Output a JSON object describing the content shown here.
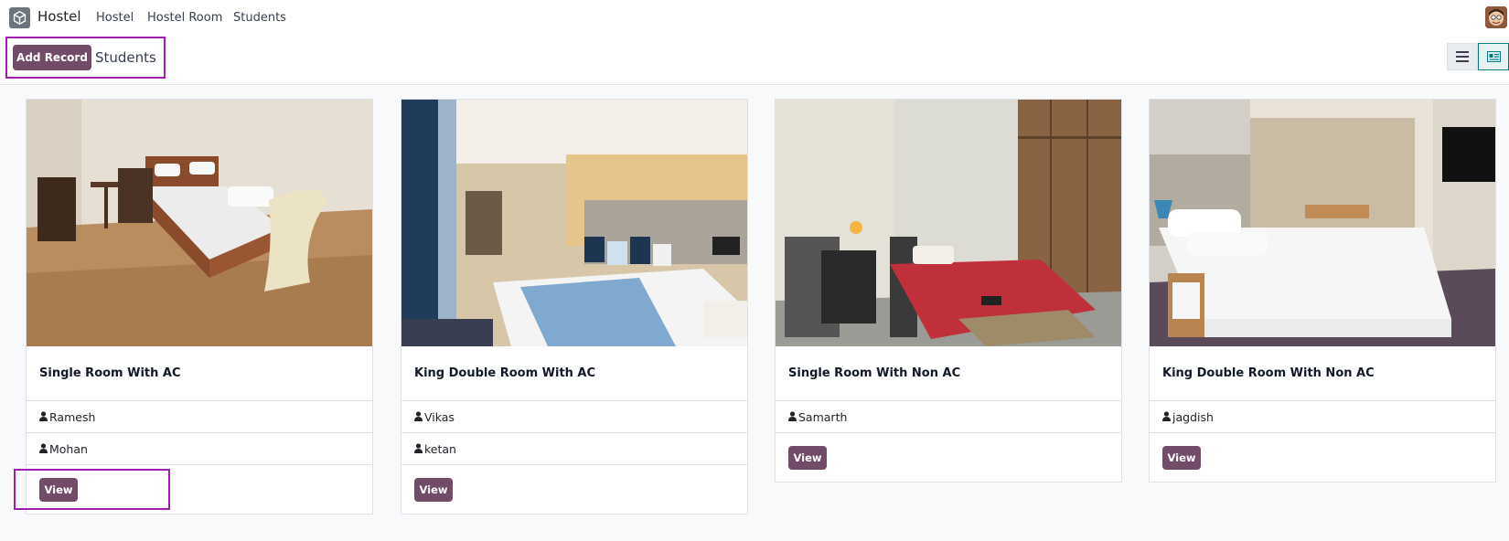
{
  "app": {
    "name": "Hostel"
  },
  "nav": {
    "items": [
      "Hostel",
      "Hostel Room",
      "Students"
    ]
  },
  "control_panel": {
    "add_record_label": "Add Record",
    "breadcrumb": "Students"
  },
  "cards": [
    {
      "title": "Single Room With AC",
      "students": [
        "Ramesh",
        "Mohan"
      ],
      "view_label": "View"
    },
    {
      "title": "King Double Room With AC",
      "students": [
        "Vikas",
        "ketan"
      ],
      "view_label": "View"
    },
    {
      "title": "Single Room With Non AC",
      "students": [
        "Samarth"
      ],
      "view_label": "View"
    },
    {
      "title": "King Double Room With Non AC",
      "students": [
        "jagdish"
      ],
      "view_label": "View"
    }
  ],
  "colors": {
    "primary": "#714b67",
    "highlight": "#a21caf",
    "active_view": "#017e84"
  }
}
